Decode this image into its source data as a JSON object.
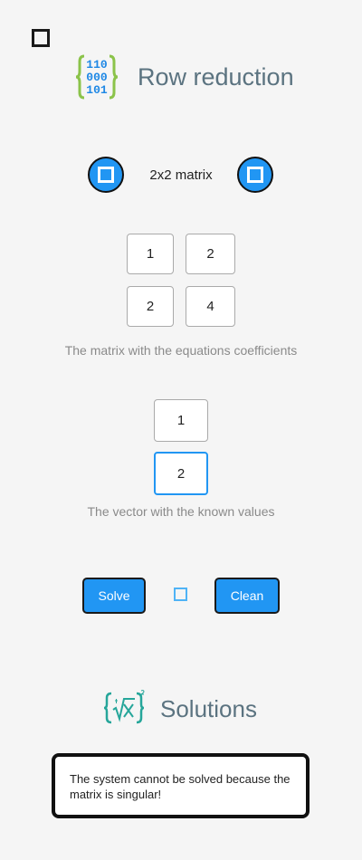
{
  "app": {
    "title": "Row reduction"
  },
  "logo": {
    "rows": [
      "110",
      "000",
      "101"
    ]
  },
  "matrix": {
    "size_label": "2x2 matrix",
    "cells": [
      [
        "1",
        "2"
      ],
      [
        "2",
        "4"
      ]
    ],
    "caption": "The matrix with the equations coefficients"
  },
  "vector": {
    "values": [
      "1",
      "2"
    ],
    "caption": "The vector with the known values"
  },
  "actions": {
    "solve_label": "Solve",
    "clean_label": "Clean"
  },
  "solutions": {
    "title": "Solutions",
    "message": "The system cannot be solved because the matrix is singular!"
  },
  "colors": {
    "accent": "#2196f3",
    "title": "#5b7380",
    "logo_blue": "#1e88e5",
    "logo_green": "#8bc34a",
    "solution_icon": "#26a69a"
  },
  "icons": {
    "menu": "square-icon",
    "app_logo": "binary-matrix-icon",
    "solutions": "root-formula-icon"
  }
}
